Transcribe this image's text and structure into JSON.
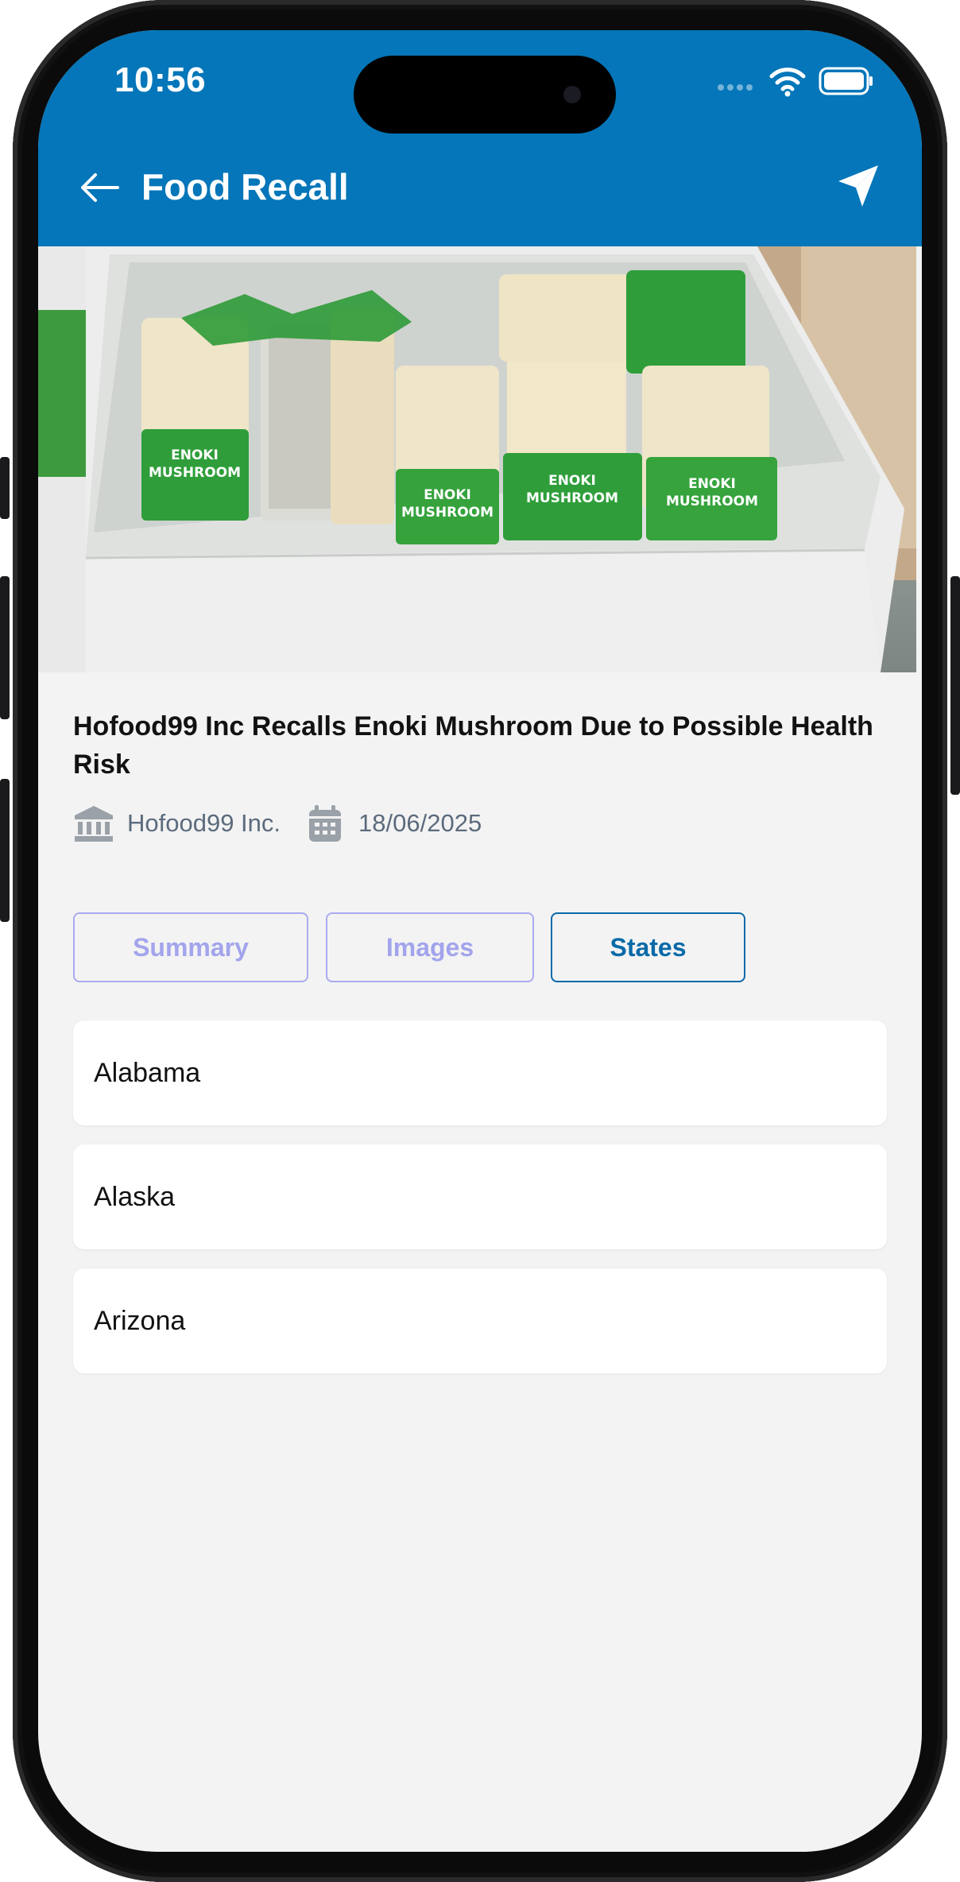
{
  "status_bar": {
    "time": "10:56"
  },
  "header": {
    "title": "Food Recall"
  },
  "hero": {
    "package_label_line1": "ENOKI",
    "package_label_line2": "MUSHROOM"
  },
  "article": {
    "title": "Hofood99 Inc Recalls Enoki Mushroom Due to Possible Health Risk",
    "company": "Hofood99 Inc.",
    "date": "18/06/2025"
  },
  "tabs": [
    {
      "label": "Summary",
      "active": false
    },
    {
      "label": "Images",
      "active": false
    },
    {
      "label": "States",
      "active": true
    }
  ],
  "states": [
    "Alabama",
    "Alaska",
    "Arizona"
  ],
  "colors": {
    "header_bg": "#0476b9",
    "screen_bg": "#f3f3f3",
    "tab_active": "#0a6aa8",
    "tab_inactive": "#a2a4ec",
    "meta_text": "#5c6b7d"
  }
}
